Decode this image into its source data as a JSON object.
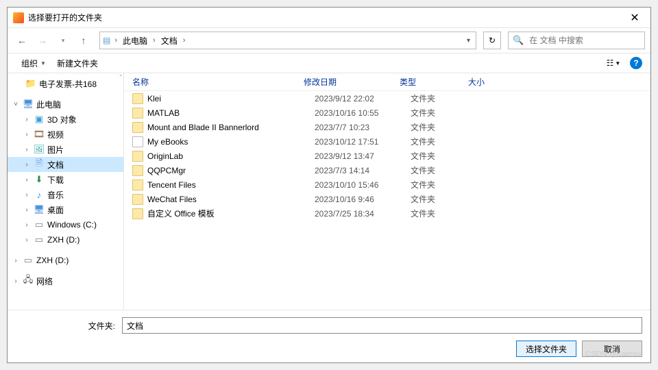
{
  "window": {
    "title": "选择要打开的文件夹"
  },
  "nav": {
    "crumbs": [
      "此电脑",
      "文档"
    ],
    "search_placeholder": "在 文档 中搜索"
  },
  "toolbar": {
    "organize": "组织",
    "newfolder": "新建文件夹",
    "help_glyph": "?"
  },
  "tree": {
    "top_item": "电子发票-共168",
    "pc": "此电脑",
    "items": [
      {
        "label": "3D 对象",
        "icon": "ic-3d"
      },
      {
        "label": "视频",
        "icon": "ic-video"
      },
      {
        "label": "图片",
        "icon": "ic-pic"
      },
      {
        "label": "文档",
        "icon": "ic-doc",
        "selected": true
      },
      {
        "label": "下载",
        "icon": "ic-down"
      },
      {
        "label": "音乐",
        "icon": "ic-music"
      },
      {
        "label": "桌面",
        "icon": "ic-desk"
      },
      {
        "label": "Windows (C:)",
        "icon": "ic-drive"
      },
      {
        "label": "ZXH (D:)",
        "icon": "ic-drive"
      }
    ],
    "extra_drive": "ZXH (D:)",
    "network": "网络"
  },
  "columns": {
    "name": "名称",
    "date": "修改日期",
    "type": "类型",
    "size": "大小"
  },
  "files": [
    {
      "name": "Klei",
      "date": "2023/9/12 22:02",
      "type": "文件夹",
      "icon": "folder"
    },
    {
      "name": "MATLAB",
      "date": "2023/10/16 10:55",
      "type": "文件夹",
      "icon": "folder"
    },
    {
      "name": "Mount and Blade II Bannerlord",
      "date": "2023/7/7 10:23",
      "type": "文件夹",
      "icon": "folder"
    },
    {
      "name": "My eBooks",
      "date": "2023/10/12 17:51",
      "type": "文件夹",
      "icon": "ebook"
    },
    {
      "name": "OriginLab",
      "date": "2023/9/12 13:47",
      "type": "文件夹",
      "icon": "folder"
    },
    {
      "name": "QQPCMgr",
      "date": "2023/7/3 14:14",
      "type": "文件夹",
      "icon": "folder"
    },
    {
      "name": "Tencent Files",
      "date": "2023/10/10 15:46",
      "type": "文件夹",
      "icon": "folder"
    },
    {
      "name": "WeChat Files",
      "date": "2023/10/16 9:46",
      "type": "文件夹",
      "icon": "folder"
    },
    {
      "name": "自定义 Office 模板",
      "date": "2023/7/25 18:34",
      "type": "文件夹",
      "icon": "folder"
    }
  ],
  "bottom": {
    "folder_label": "文件夹:",
    "folder_value": "文档",
    "select_btn": "选择文件夹",
    "cancel_btn": "取消"
  },
  "watermark": "CSDN @Kaerou"
}
